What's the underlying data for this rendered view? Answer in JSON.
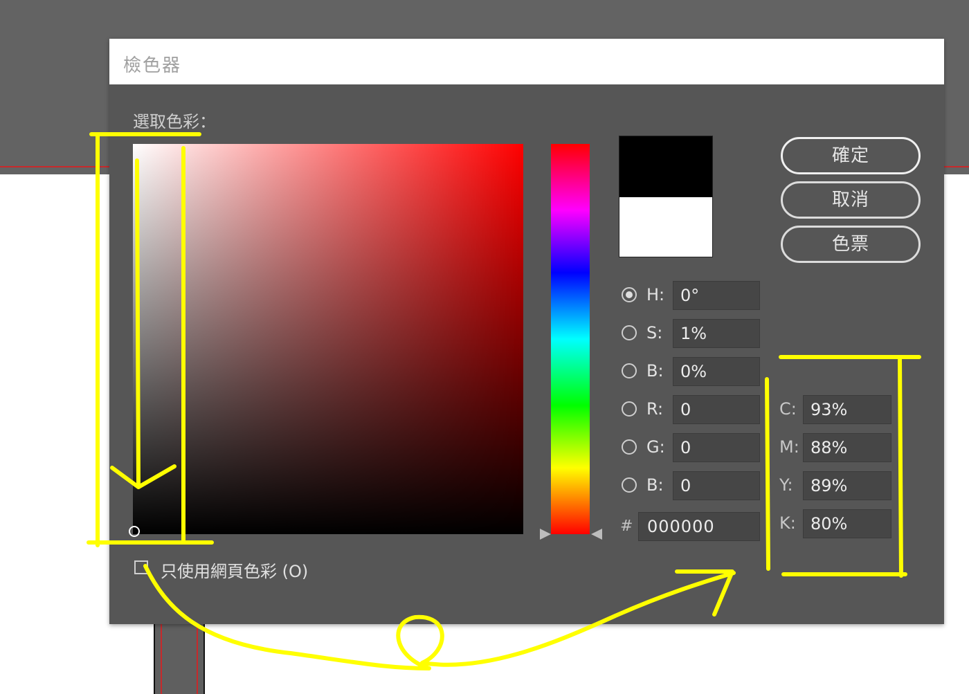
{
  "dialog": {
    "title": "檢色器",
    "pick_label": "選取色彩：",
    "buttons": {
      "ok": "確定",
      "cancel": "取消",
      "swatches": "色票"
    }
  },
  "preview": {
    "new_color": "#000000",
    "old_color": "#ffffff"
  },
  "hsb_rgb": [
    {
      "label": "H:",
      "value": "0°",
      "selected": true
    },
    {
      "label": "S:",
      "value": "1%",
      "selected": false
    },
    {
      "label": "B:",
      "value": "0%",
      "selected": false
    },
    {
      "label": "R:",
      "value": "0",
      "selected": false
    },
    {
      "label": "G:",
      "value": "0",
      "selected": false
    },
    {
      "label": "B:",
      "value": "0",
      "selected": false
    }
  ],
  "hex": {
    "hash": "#",
    "value": "000000"
  },
  "cmyk": [
    {
      "label": "C:",
      "value": "93%"
    },
    {
      "label": "M:",
      "value": "88%"
    },
    {
      "label": "Y:",
      "value": "89%"
    },
    {
      "label": "K:",
      "value": "80%"
    }
  ],
  "web_only": {
    "label": "只使用網頁色彩 (O)",
    "checked": false
  },
  "colors": {
    "annotation": "#ffff00",
    "background_red_line": "#c8292b",
    "dialog_bg": "#565656"
  }
}
